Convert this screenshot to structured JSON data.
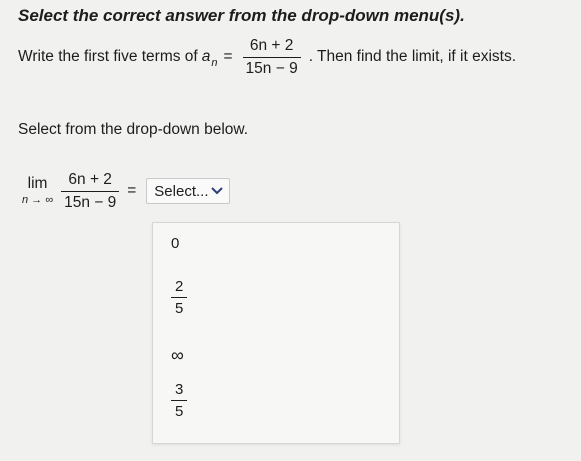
{
  "instruction": "Select the correct answer from the drop-down menu(s).",
  "question": {
    "prefix": "Write the first five terms of",
    "var": "a",
    "sub": "n",
    "eq": "=",
    "numerator": "6n + 2",
    "denominator": "15n − 9",
    "suffix": ". Then find the limit, if it exists."
  },
  "prompt": "Select from the drop-down below.",
  "limit": {
    "lim": "lim",
    "lim_sub": "n → ∞",
    "numerator": "6n + 2",
    "denominator": "15n − 9",
    "eq": "="
  },
  "select": {
    "value": "Select...",
    "chevron": "chevron-down-icon"
  },
  "options": [
    {
      "label": "0"
    },
    {
      "numerator": "2",
      "denominator": "5"
    },
    {
      "label": "∞"
    },
    {
      "numerator": "3",
      "denominator": "5"
    }
  ]
}
